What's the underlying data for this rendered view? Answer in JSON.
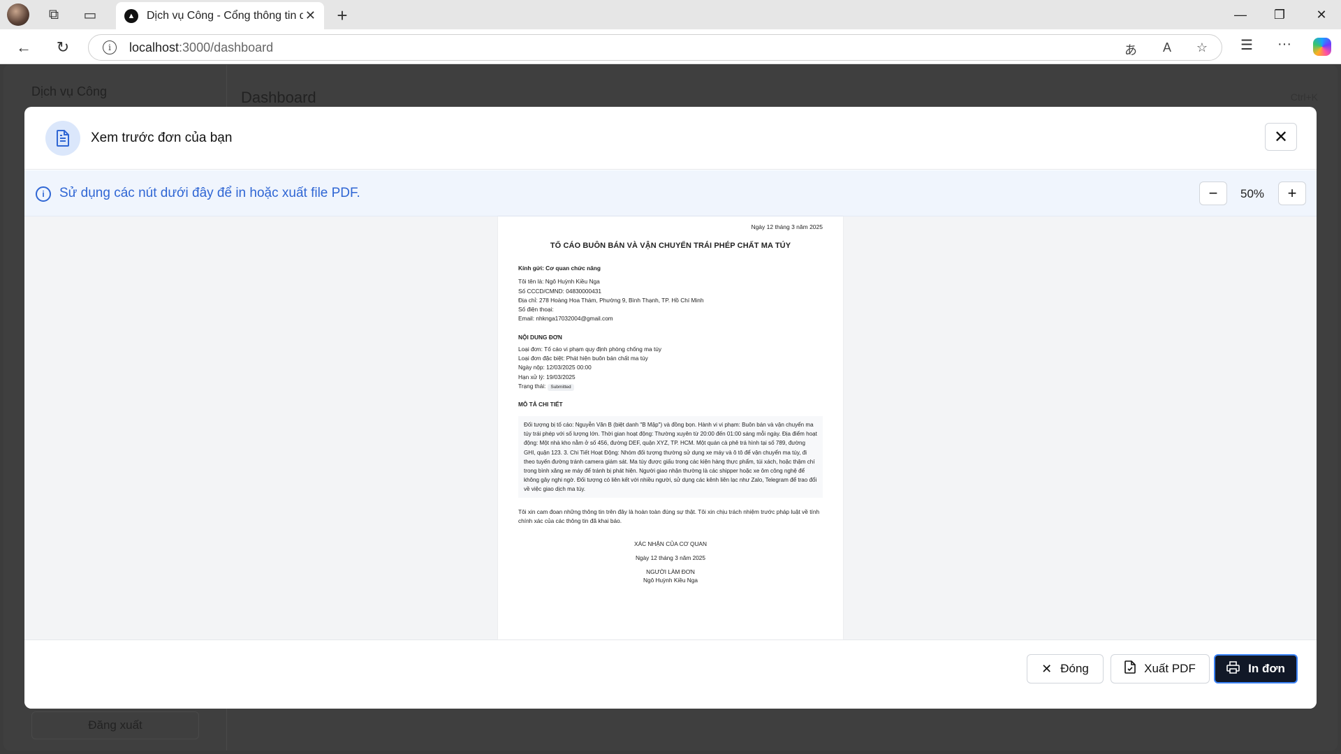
{
  "browser": {
    "tab_title": "Dịch vụ Công - Cổng thông tin dịch vụ công",
    "url_host": "localhost",
    "url_path": ":3000/dashboard"
  },
  "page": {
    "brand": "Dịch vụ Công",
    "title": "Dashboard",
    "shortcut": "Ctrl+K",
    "logout": "Đăng xuất"
  },
  "modal": {
    "title": "Xem trước đơn của bạn",
    "info": "Sử dụng các nút dưới đây để in hoặc xuất file PDF.",
    "zoom": "50%",
    "buttons": {
      "close": "Đóng",
      "export_pdf": "Xuất PDF",
      "print": "In đơn"
    }
  },
  "document": {
    "date_top": "Ngày 12 tháng 3 năm 2025",
    "title": "TỐ CÁO BUÔN BÁN VÀ VẬN CHUYỂN TRÁI PHÉP CHẤT MA TÚY",
    "recipient": "Kính gửi: Cơ quan chức năng",
    "sender": [
      "Tôi tên là: Ngô Huỳnh Kiều Nga",
      "Số CCCD/CMND: 04830000431",
      "Địa chỉ: 278 Hoàng Hoa Thám, Phường 9, Bình Thạnh, TP. Hồ Chí Minh",
      "Số điện thoại:",
      "Email: nhknga17032004@gmail.com"
    ],
    "section_content": "NỘI DUNG ĐƠN",
    "content": [
      "Loại đơn: Tố cáo vi phạm quy định phòng chống ma túy",
      "Loại đơn đặc biệt: Phát hiện buôn bán chất ma túy",
      "Ngày nộp: 12/03/2025 00:00",
      "Hạn xử lý: 19/03/2025"
    ],
    "status_label": "Trạng thái:",
    "status_value": "Submitted",
    "section_detail": "MÔ TẢ CHI TIẾT",
    "detail": "Đối tượng bị tố cáo: Nguyễn Văn B (biệt danh \"B Mập\") và đồng bọn. Hành vi vi phạm: Buôn bán và vận chuyển ma túy trái phép với số lượng lớn. Thời gian hoạt động: Thường xuyên từ 20:00 đến 01:00 sáng mỗi ngày. Địa điểm hoạt động: Một nhà kho nằm ở số 456, đường DEF, quận XYZ, TP. HCM. Một quán cà phê trá hình tại số 789, đường GHI, quận 123. 3. Chi Tiết Hoạt Động: Nhóm đối tượng thường sử dụng xe máy và ô tô để vận chuyển ma túy, đi theo tuyến đường tránh camera giám sát. Ma túy được giấu trong các kiện hàng thực phẩm, túi xách, hoặc thậm chí trong bình xăng xe máy để tránh bị phát hiện. Người giao nhận thường là các shipper hoặc xe ôm công nghệ để không gây nghi ngờ. Đối tượng có liên kết với nhiều người, sử dụng các kênh liên lạc như Zalo, Telegram để trao đổi về việc giao dịch ma túy.",
    "commitment": "Tôi xin cam đoan những thông tin trên đây là hoàn toàn đúng sự thật. Tôi xin chịu trách nhiệm trước pháp luật về tính chính xác của các thông tin đã khai báo.",
    "confirm_label": "XÁC NHẬN CỦA CƠ QUAN",
    "date_bottom": "Ngày 12 tháng 3 năm 2025",
    "signer_label": "NGƯỜI LÀM ĐƠN",
    "signer_name": "Ngô Huỳnh Kiều Nga"
  },
  "icons": {
    "document": "document-icon",
    "info": "info-icon",
    "close": "close-icon",
    "minus": "minus-icon",
    "plus": "plus-icon",
    "pdf": "file-pdf-icon",
    "printer": "printer-icon"
  },
  "colors": {
    "accent": "#2f66d4",
    "primary_button": "#111827",
    "info_bg": "#f0f5fd"
  }
}
